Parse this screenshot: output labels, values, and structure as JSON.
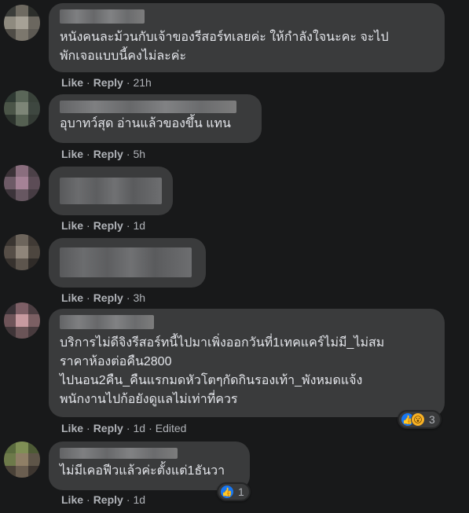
{
  "comments": [
    {
      "text": "หนังคนละม้วนกับเจ้าของรีสอร์ทเลยค่ะ ให้กำลังใจนะคะ จะไป\nพักเจอแบบนี้คงไม่ละค่ะ",
      "like": "Like",
      "reply": "Reply",
      "time": "21h",
      "edited": ""
    },
    {
      "text": "อุบาทว์สุด อ่านแล้วของขึ้น แทน",
      "like": "Like",
      "reply": "Reply",
      "time": "5h",
      "edited": ""
    },
    {
      "text": "",
      "like": "Like",
      "reply": "Reply",
      "time": "1d",
      "edited": ""
    },
    {
      "text": "",
      "like": "Like",
      "reply": "Reply",
      "time": "3h",
      "edited": ""
    },
    {
      "text": "บริการไม่ดีจิงรีสอร์ทนี้ไปมาเพิ่งออกวันที่1เทคแคร์ไม่มี_ไม่สม\nราคาห้องต่อคืน2800\nไปนอน2คืน_คืนแรกมดหัวโตๆกัดกินรองเท้า_พังหมดแจ้ง\nพนักงานไปก้อยังดูแลไม่เท่าที่ควร",
      "like": "Like",
      "reply": "Reply",
      "time": "1d",
      "edited": "Edited",
      "reaction_count": "3"
    },
    {
      "text": "ไม่มีเคอฟีวแล้วค่ะตั้งแต่1ธันวา",
      "like": "Like",
      "reply": "Reply",
      "time": "1d",
      "edited": "",
      "reaction_count": "1"
    }
  ],
  "colors": {
    "background": "#18191a",
    "bubble": "#3a3b3c",
    "text": "#e4e6eb",
    "meta": "#b0b3b8",
    "like_blue": "#1877f2",
    "wow_yellow": "#f7b125"
  },
  "icons": {
    "like": "like-reaction-icon",
    "wow": "wow-reaction-icon"
  }
}
